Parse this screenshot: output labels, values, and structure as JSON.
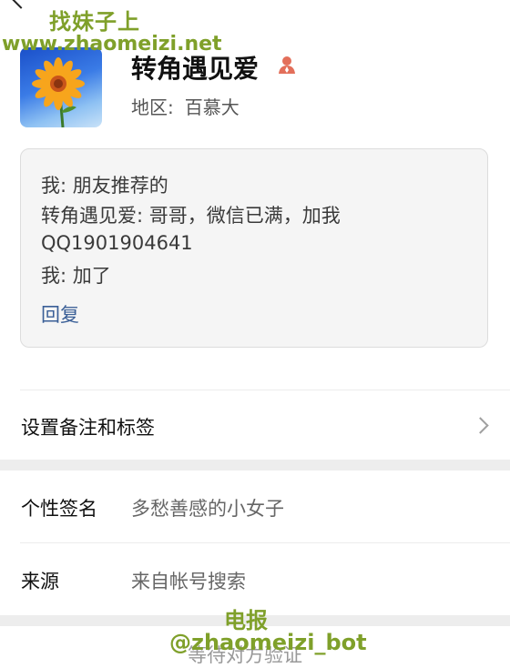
{
  "watermark": {
    "top_line1": "找妹子上",
    "top_line2": "www.zhaomeizi.net",
    "bottom_line1": "电报",
    "bottom_line2": "@zhaomeizi_bot"
  },
  "profile": {
    "nickname": "转角遇见爱",
    "region_label": "地区:",
    "region_value": "百慕大",
    "gender_icon": "female-user-icon"
  },
  "message": {
    "lines": [
      "我: 朋友推荐的",
      "转角遇见爱: 哥哥，微信已满，加我",
      "QQ1901904641",
      "我: 加了"
    ],
    "reply_label": "回复"
  },
  "settings": {
    "remark_label": "设置备注和标签",
    "signature_label": "个性签名",
    "signature_value": "多愁善感的小女子",
    "source_label": "来源",
    "source_value": "来自帐号搜索",
    "pending_value": "等待对方验证"
  },
  "colors": {
    "watermark": "#7fa02a",
    "reply_link": "#3a5f97",
    "gender_icon": "#e36f5a"
  }
}
